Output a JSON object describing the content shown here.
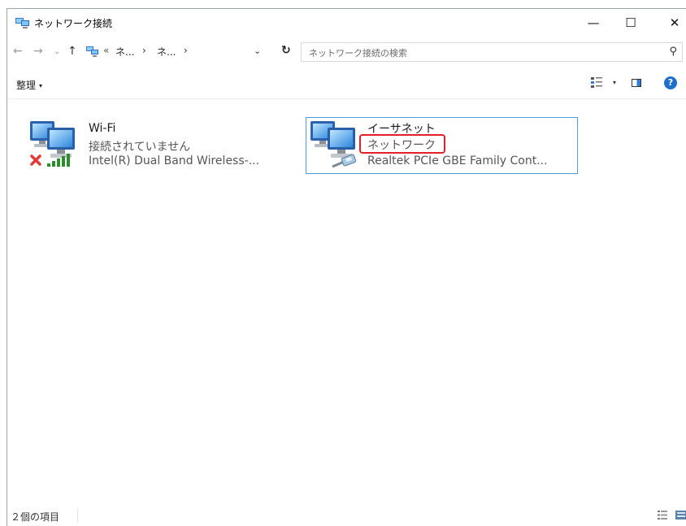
{
  "window": {
    "title": "ネットワーク接続"
  },
  "titlebar_buttons": {
    "minimize": "—",
    "maximize": "☐",
    "close": "✕"
  },
  "address": {
    "more": "«",
    "crumbs": [
      "ネ...",
      "ネ..."
    ],
    "separator": "›",
    "search_placeholder": "ネットワーク接続の検索"
  },
  "command_bar": {
    "organize_label": "整理"
  },
  "connections": [
    {
      "name": "Wi-Fi",
      "status": "接続されていません",
      "device": "Intel(R) Dual Band Wireless-...",
      "state_icon": "disconnected-x-icon",
      "selected": false
    },
    {
      "name": "イーサネット",
      "status": "ネットワーク",
      "device": "Realtek PCIe GBE Family Cont...",
      "state_icon": "ethernet-cable-icon",
      "selected": true
    }
  ],
  "annotation": {
    "color": "#e0202a"
  },
  "statusbar": {
    "item_count": "２個の項目"
  },
  "colors": {
    "selection_border": "#4a9ee0",
    "accent": "#1f6fc9"
  }
}
